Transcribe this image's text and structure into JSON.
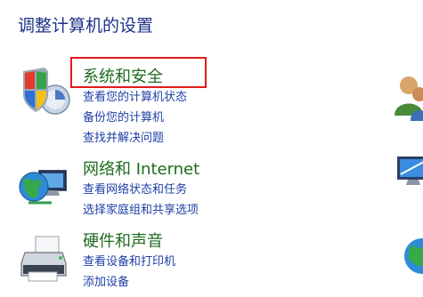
{
  "page": {
    "title": "调整计算机的设置"
  },
  "categories": [
    {
      "title": "系统和安全",
      "icon": "shield-icon",
      "links": [
        "查看您的计算机状态",
        "备份您的计算机",
        "查找并解决问题"
      ]
    },
    {
      "title": "网络和 Internet",
      "icon": "network-globe-icon",
      "links": [
        "查看网络状态和任务",
        "选择家庭组和共享选项"
      ]
    },
    {
      "title": "硬件和声音",
      "icon": "printer-icon",
      "links": [
        "查看设备和打印机",
        "添加设备"
      ]
    }
  ],
  "colors": {
    "category_title": "#1e6b1e",
    "link": "#1f3fa6",
    "page_title": "#1e3287",
    "highlight": "#e21b1b"
  }
}
